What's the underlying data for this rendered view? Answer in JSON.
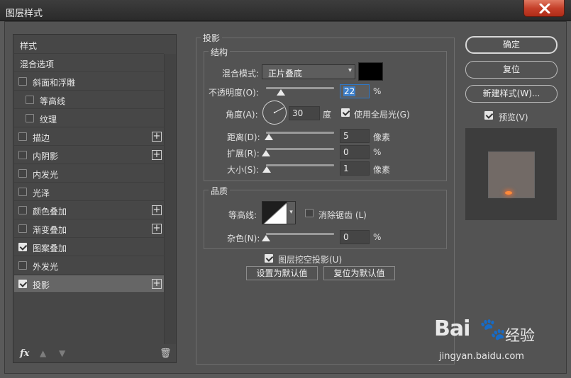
{
  "window": {
    "title": "图层样式",
    "close_icon": "close-icon"
  },
  "left_panel": {
    "items": [
      {
        "label": "样式",
        "has_checkbox": false,
        "checked": false,
        "has_plus": false
      },
      {
        "label": "混合选项",
        "has_checkbox": false,
        "checked": false,
        "has_plus": false
      },
      {
        "label": "斜面和浮雕",
        "has_checkbox": true,
        "checked": false,
        "has_plus": false
      },
      {
        "label": "等高线",
        "has_checkbox": true,
        "checked": false,
        "has_plus": false,
        "indent": true
      },
      {
        "label": "纹理",
        "has_checkbox": true,
        "checked": false,
        "has_plus": false,
        "indent": true
      },
      {
        "label": "描边",
        "has_checkbox": true,
        "checked": false,
        "has_plus": true
      },
      {
        "label": "内阴影",
        "has_checkbox": true,
        "checked": false,
        "has_plus": true
      },
      {
        "label": "内发光",
        "has_checkbox": true,
        "checked": false,
        "has_plus": false
      },
      {
        "label": "光泽",
        "has_checkbox": true,
        "checked": false,
        "has_plus": false
      },
      {
        "label": "颜色叠加",
        "has_checkbox": true,
        "checked": false,
        "has_plus": true
      },
      {
        "label": "渐变叠加",
        "has_checkbox": true,
        "checked": false,
        "has_plus": true
      },
      {
        "label": "图案叠加",
        "has_checkbox": true,
        "checked": true,
        "has_plus": false
      },
      {
        "label": "外发光",
        "has_checkbox": true,
        "checked": false,
        "has_plus": false
      },
      {
        "label": "投影",
        "has_checkbox": true,
        "checked": true,
        "has_plus": true,
        "selected": true
      }
    ],
    "footer": {
      "fx_label": "fx",
      "up_icon": "arrow-up-icon",
      "down_icon": "arrow-down-icon",
      "trash_icon": "trash-icon"
    }
  },
  "drop_shadow": {
    "title": "投影",
    "structure": {
      "title": "结构",
      "blend_mode_label": "混合模式:",
      "blend_mode_value": "正片叠底",
      "shadow_color": "#000000",
      "opacity_label": "不透明度(O):",
      "opacity_value": "22",
      "opacity_unit": "%",
      "angle_label": "角度(A):",
      "angle_value": "30",
      "angle_unit": "度",
      "global_light_label": "使用全局光(G)",
      "global_light_checked": true,
      "distance_label": "距离(D):",
      "distance_value": "5",
      "distance_unit": "像素",
      "spread_label": "扩展(R):",
      "spread_value": "0",
      "spread_unit": "%",
      "size_label": "大小(S):",
      "size_value": "1",
      "size_unit": "像素"
    },
    "quality": {
      "title": "品质",
      "contour_label": "等高线:",
      "antialias_label": "消除锯齿 (L)",
      "antialias_checked": false,
      "noise_label": "杂色(N):",
      "noise_value": "0",
      "noise_unit": "%"
    },
    "knockout_label": "图层挖空投影(U)",
    "knockout_checked": true,
    "set_default_label": "设置为默认值",
    "reset_default_label": "复位为默认值"
  },
  "right": {
    "ok_label": "确定",
    "reset_label": "复位",
    "new_style_label": "新建样式(W)...",
    "preview_label": "预览(V)",
    "preview_checked": true,
    "preview_glow_color": "#ff8a3a"
  },
  "watermark": {
    "logo": "Bai",
    "logo2": "du",
    "cn": "经验",
    "url": "jingyan.baidu.com"
  }
}
